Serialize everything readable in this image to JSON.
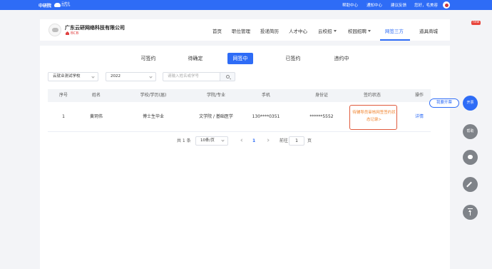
{
  "topbar": {
    "logo_text": "中研院",
    "cloud_logo_text": "云就业",
    "cloud_logo_sub": "YUN JIUYE",
    "links": [
      "帮助中心",
      "通知中心",
      "建议反馈",
      "您好，毛美容"
    ],
    "colors": {
      "bg": "#2e6cf6"
    }
  },
  "header": {
    "company_name": "广东云研网络科技有限公司",
    "company_tag": "BCB",
    "nav": [
      {
        "label": "首页"
      },
      {
        "label": "职位管理"
      },
      {
        "label": "投递简历"
      },
      {
        "label": "人才中心"
      },
      {
        "label": "云校招"
      },
      {
        "label": "校园招聘"
      },
      {
        "label": "网签三方",
        "active": true
      },
      {
        "label": "道具商城"
      }
    ],
    "new_badge": "new"
  },
  "tabs": [
    {
      "label": "可签约"
    },
    {
      "label": "待确定"
    },
    {
      "label": "网签中",
      "active": true
    },
    {
      "label": "已签约"
    },
    {
      "label": "违约中"
    }
  ],
  "filters": {
    "school_select": "云就业测试学校",
    "year_select": "2022",
    "search_placeholder": "请输入姓名或学号"
  },
  "table": {
    "headers": [
      "序号",
      "姓名",
      "学校/学历(届)",
      "学院/专业",
      "手机",
      "身份证",
      "签约状态",
      "操作"
    ],
    "rows": [
      {
        "index": "1",
        "name": "黄玥伟",
        "school": "博士生毕业",
        "major": "文学院 / 基础医学",
        "phone": "130****0351",
        "id_card": "******5552",
        "status": "待辅导员审核网签签约状态记录>",
        "action": "详情"
      }
    ]
  },
  "pager": {
    "total": "共 1 条",
    "page_size": "10条/页",
    "current": "1",
    "goto_label": "前往",
    "goto_value": "1",
    "page_suffix": "页"
  },
  "float": {
    "pill": "我要开票",
    "fab_invoice": "开票",
    "fab_help": "帮助"
  },
  "colors": {
    "accent": "#2e6cf6",
    "status_text": "#f0842f",
    "status_border": "#e05a3c",
    "badge": "#e8453c"
  }
}
